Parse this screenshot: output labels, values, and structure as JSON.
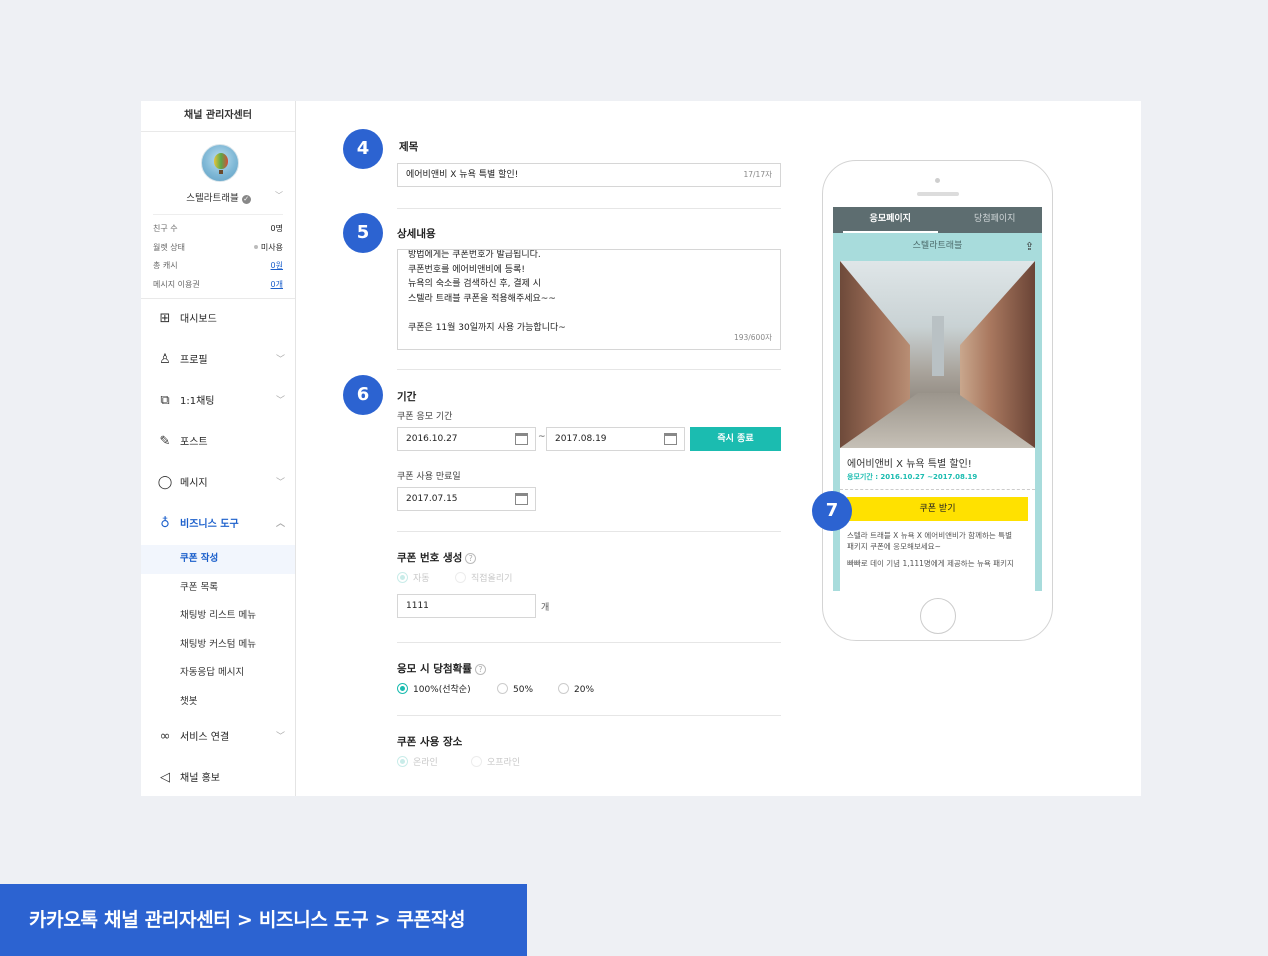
{
  "sidebar": {
    "title": "채널 관리자센터",
    "channel_name": "스텔라트래블",
    "verified_mark": "✓",
    "stats": [
      {
        "label": "친구 수",
        "value": "0명"
      },
      {
        "label": "월렛 상태",
        "value": "미사용"
      },
      {
        "label": "총 캐시",
        "value": "0원"
      },
      {
        "label": "메시지 이용권",
        "value": "0개"
      }
    ],
    "menu": [
      {
        "label": "대시보드",
        "icon": "dashboard-icon"
      },
      {
        "label": "프로필",
        "icon": "person-icon"
      },
      {
        "label": "1:1채팅",
        "icon": "chat-icon"
      },
      {
        "label": "포스트",
        "icon": "edit-icon"
      },
      {
        "label": "메시지",
        "icon": "speech-bubble-icon"
      },
      {
        "label": "비즈니스 도구",
        "icon": "lightbulb-icon"
      },
      {
        "label": "서비스 연결",
        "icon": "link-icon"
      },
      {
        "label": "채널 홍보",
        "icon": "megaphone-icon"
      }
    ],
    "submenu": [
      {
        "label": "쿠폰 작성"
      },
      {
        "label": "쿠폰 목록"
      },
      {
        "label": "채팅방 리스트 메뉴"
      },
      {
        "label": "채팅방 커스텀 메뉴"
      },
      {
        "label": "자동응답 메시지"
      },
      {
        "label": "챗봇"
      }
    ]
  },
  "form": {
    "badges": [
      "4",
      "5",
      "6",
      "7"
    ],
    "title_section": {
      "label": "제목",
      "value": "에어비앤비 X 뉴욕 특별 할인!",
      "counter": "17/17자"
    },
    "detail_section": {
      "label": "상세내용",
      "lines": [
        "방법에게는 쿠폰번호가 발급됩니다.",
        "쿠폰번호를 에어비앤비에 등록!",
        "뉴욕의 숙소를 검색하신 후, 결제 시",
        "스텔라 트래블 쿠폰을 적용해주세요~~",
        "",
        "쿠폰은 11월 30일까지 사용 가능합니다~"
      ],
      "counter": "193/600자"
    },
    "period_section": {
      "label": "기간",
      "apply_label": "쿠폰 응모 기간",
      "start": "2016.10.27",
      "tilde": "~",
      "end": "2017.08.19",
      "end_now_button": "즉시 종료",
      "expiry_label": "쿠폰 사용 만료일",
      "expiry": "2017.07.15"
    },
    "coupon_number": {
      "label": "쿠폰 번호 생성",
      "help": "?",
      "options": [
        "자동",
        "직접올리기"
      ],
      "value": "1111",
      "unit": "개"
    },
    "win_rate": {
      "label": "응모 시 당첨확률",
      "help": "?",
      "options": [
        "100%(선착순)",
        "50%",
        "20%"
      ]
    },
    "usage_place": {
      "label": "쿠폰 사용 장소",
      "options": [
        "온라인",
        "오프라인"
      ]
    }
  },
  "phone": {
    "tabs": [
      "응모페이지",
      "당첨페이지"
    ],
    "header": "스텔라트래블",
    "share_icon": "⇪",
    "card_title": "에어비앤비 X 뉴욕 특별 할인!",
    "card_period": "응모기간 : 2016.10.27 ~2017.08.19",
    "receive_button": "쿠폰 받기",
    "desc_lines": [
      "스텔라 트래블 X 뉴욕 X 에어비앤비가 함께하는 특별",
      "패키지 쿠폰에 응모해보세요~",
      "",
      "빠빠로 데이 기념 1,111명에게 제공하는 뉴욕 패키지"
    ]
  },
  "caption": "카카오톡 채널 관리자센터 > 비즈니스 도구 > 쿠폰작성",
  "colors": {
    "accent": "#2c63d1",
    "teal": "#1bbcb0",
    "yellow": "#ffe100",
    "phone_bg": "#a8dcdc"
  }
}
